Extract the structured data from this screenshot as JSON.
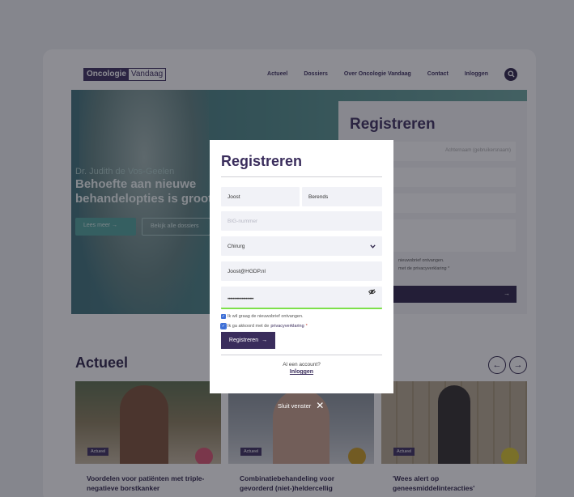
{
  "header": {
    "logo_part1": "Oncologie",
    "logo_part2": "Vandaag",
    "nav": [
      "Actueel",
      "Dossiers",
      "Over Oncologie Vandaag",
      "Contact",
      "Inloggen"
    ],
    "search_icon": "search-icon"
  },
  "hero": {
    "subtitle": "Dr. Judith de Vos-Geelen",
    "title": "Behoefte aan nieuwe behandelopties is groot",
    "button_primary": "Lees meer →",
    "button_secondary": "Bekijk alle dossiers"
  },
  "background_form": {
    "title": "Registreren",
    "hint": "Achternaam (gebruikersnaam)",
    "check1": "nieuwsbrief ontvangen.",
    "check2": "met de privacyverklaring *",
    "submit_arrow": "→"
  },
  "actueel": {
    "title": "Actueel",
    "prev": "←",
    "next": "→",
    "cards": [
      {
        "tag": "Actueel",
        "title": "Voordelen voor patiënten met triple-negatieve borstkanker",
        "dot_color": "#d9536f"
      },
      {
        "tag": "Actueel",
        "title": "Combinatiebehandeling voor gevorderd (niet-)heldercellig",
        "dot_color": "#c99a1e"
      },
      {
        "tag": "Actueel",
        "title": "'Wees alert op geneesmiddelinteracties'",
        "dot_color": "#d8c52a"
      }
    ]
  },
  "modal": {
    "title": "Registreren",
    "first_name": "Joost",
    "last_name": "Berends",
    "big_placeholder": "BIG-nummer",
    "specialism": "Chirurg",
    "email": "Joost@HGDP.nl",
    "password_mask": "••••••••••••••••••••",
    "check_newsletter": "Ik wil graag de nieuwsbrief ontvangen.",
    "check_privacy_prefix": "Ik ga akkoord met de",
    "check_privacy_link": "privacyverklaring",
    "check_privacy_required": "*",
    "submit_label": "Registreren",
    "submit_arrow": "→",
    "account_question": "Al een account?",
    "login_link": "Inloggen"
  },
  "close_label": "Sluit venster",
  "colors": {
    "brand": "#3a2d5c",
    "valid": "#7de04a",
    "checkbox": "#3d6fd6"
  }
}
